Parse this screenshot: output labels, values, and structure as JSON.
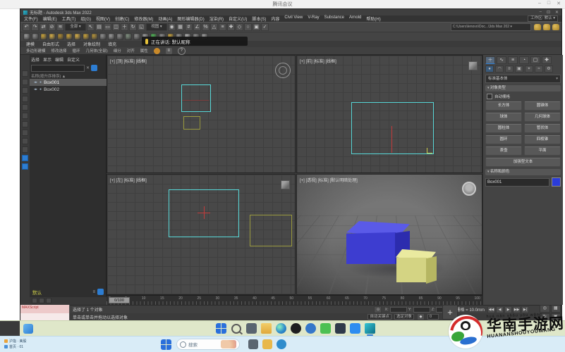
{
  "meeting": {
    "title": "腾讯会议",
    "controls": [
      "–",
      "□",
      "✕"
    ],
    "speaking_banner": "正在讲话: 默认昵称"
  },
  "max": {
    "window_title": "无标题 - Autodesk 3ds Max 2022",
    "window_controls": [
      "–",
      "⊡",
      "✕"
    ],
    "menus": [
      "文件(F)",
      "编辑(E)",
      "工具(T)",
      "组(G)",
      "视图(V)",
      "创建(C)",
      "修改器(M)",
      "动画(A)",
      "图形编辑器(D)",
      "渲染(R)",
      "自定义(U)",
      "脚本(S)",
      "内容",
      "Civil View",
      "V-Ray",
      "Substance",
      "Arnold",
      "帮助(H)"
    ],
    "workspace": "工作区: 默认 ▾",
    "project_path": "C:\\Users\\lenovo\\Doc...\\3ds Max 202 ▾",
    "toolbar_main_glyphs": [
      "↶",
      "↷",
      "⇄",
      "⊘",
      "≋",
      "全部",
      "↖",
      "▤",
      "▭",
      "◫",
      "＋",
      "↻",
      "◱",
      "视图",
      "◉",
      "▦",
      "#",
      "∠",
      "%",
      "△",
      "≡",
      "✚",
      "◇",
      "○",
      "▣",
      "✓"
    ],
    "toolbar_secondary_colors": [
      "#9a9a9a",
      "#8a8a8a",
      "#c9a23a",
      "#d6ae46",
      "#b08a2e",
      "#c9a23a",
      "#d6ae46",
      "#c9a23a",
      "#b4923a",
      "#8f8f8f",
      "#9a9a9a",
      "#8a8a8a",
      "#7f8f7f",
      "#8a8a8a",
      "#9a9a9a",
      "#4db353",
      "#8a8a8a",
      "#c9a23a",
      "#8f8f8f",
      "#b0b0b0",
      "#8a8a8a",
      "#9a9a9a"
    ],
    "ribbon": {
      "tabs": [
        "建模",
        "自由形式",
        "选择",
        "对象绘制",
        "填充"
      ],
      "panels": [
        "多边形建模",
        "修改选择",
        "循环",
        "几何体(全部)",
        "细分",
        "对齐",
        "属性"
      ],
      "tray_icons": [
        "bell",
        "list",
        "help"
      ]
    },
    "explorer": {
      "tabs": [
        "选择",
        "显示",
        "编辑",
        "自定义"
      ],
      "sort_header": "名称(按升序排序) ▲",
      "rows": [
        {
          "name": "Box001",
          "selected": true
        },
        {
          "name": "Box002",
          "selected": false
        }
      ],
      "footer": "默认",
      "strip_icon_count": 12
    },
    "viewport_labels": {
      "top": "[+] [顶] [标准] [线框]",
      "front": "[+] [前] [标准] [线框]",
      "left": "[+] [左] [标准] [线框]",
      "persp": "[+] [透视] [标准] [默认明暗处理]"
    },
    "command_panel": {
      "tab_glyphs": [
        "＋",
        "∿",
        "≡",
        "◔",
        "▢",
        "✚"
      ],
      "subcat_glyphs": [
        "●",
        "◠",
        "¤",
        "▣",
        "⌖",
        "≈",
        "⚙"
      ],
      "category_dropdown": "标准基本体",
      "rollout_object_type": "对象类型",
      "autogrid": "自动栅格",
      "buttons": [
        [
          "长方体",
          "圆锥体"
        ],
        [
          "球体",
          "几何球体"
        ],
        [
          "圆柱体",
          "管状体"
        ],
        [
          "圆环",
          "四棱锥"
        ],
        [
          "茶壶",
          "平面"
        ]
      ],
      "wide_button": "加强型文本",
      "rollout_name_color": "名称和颜色",
      "object_name": "Box001",
      "object_color": "#2b3cd8"
    },
    "timeline": {
      "slider": "0/100",
      "ticks": [
        0,
        5,
        10,
        15,
        20,
        25,
        30,
        35,
        40,
        45,
        50,
        55,
        60,
        65,
        70,
        75,
        80,
        85,
        90,
        95,
        100
      ]
    },
    "status": {
      "listener_label": "MAXScript",
      "selection": "选择了 1 个对象",
      "prompt": "单击或单击并拖动以选择对象",
      "coord_labels": [
        "X:",
        "Y:",
        "Z:"
      ],
      "grid": "栅格 = 10.0mm",
      "auto_key": "自动关键点",
      "selected_filter": "选定对象",
      "time": "0",
      "playback": [
        "◀◀",
        "◀",
        "▶",
        "▶▶",
        "▶|"
      ],
      "nav_glyphs": [
        "◎",
        "▦",
        "↻",
        "▣"
      ],
      "pan_glyph": "+"
    }
  },
  "taskbar_shared": {
    "icons": [
      {
        "name": "start",
        "type": "grid4"
      },
      {
        "name": "search",
        "type": "ring"
      },
      {
        "name": "task-view",
        "c": "#5a6570"
      },
      {
        "name": "file-explorer",
        "type": "folder"
      },
      {
        "name": "edge",
        "type": "edge"
      },
      {
        "name": "app-dark-circle",
        "c": "#1e1e20",
        "round": true
      },
      {
        "name": "app-blue",
        "c": "#3577c9",
        "round": true
      },
      {
        "name": "wechat",
        "c": "#4cc052"
      },
      {
        "name": "app-dark",
        "c": "#2f3a4a"
      },
      {
        "name": "tencent-meeting",
        "c": "#2d8cf0"
      },
      {
        "name": "3dsmax",
        "type": "max3d",
        "active": true
      }
    ]
  },
  "taskbar_local": {
    "widget_line1": "沪指 · 美股",
    "widget_line2": "首页 · 01",
    "search_label": "搜索",
    "icons": [
      {
        "name": "task-view",
        "c": "#5a6570"
      },
      {
        "name": "file-explorer",
        "c": "#e8b84b"
      },
      {
        "name": "edge",
        "c": "#2f8ccc",
        "round": true
      }
    ]
  },
  "watermark": {
    "pinyin": "huá nán shǒu yóu wǎng",
    "text": "华南手游网",
    "latin": "HUANANSHOUYOUWANG"
  }
}
